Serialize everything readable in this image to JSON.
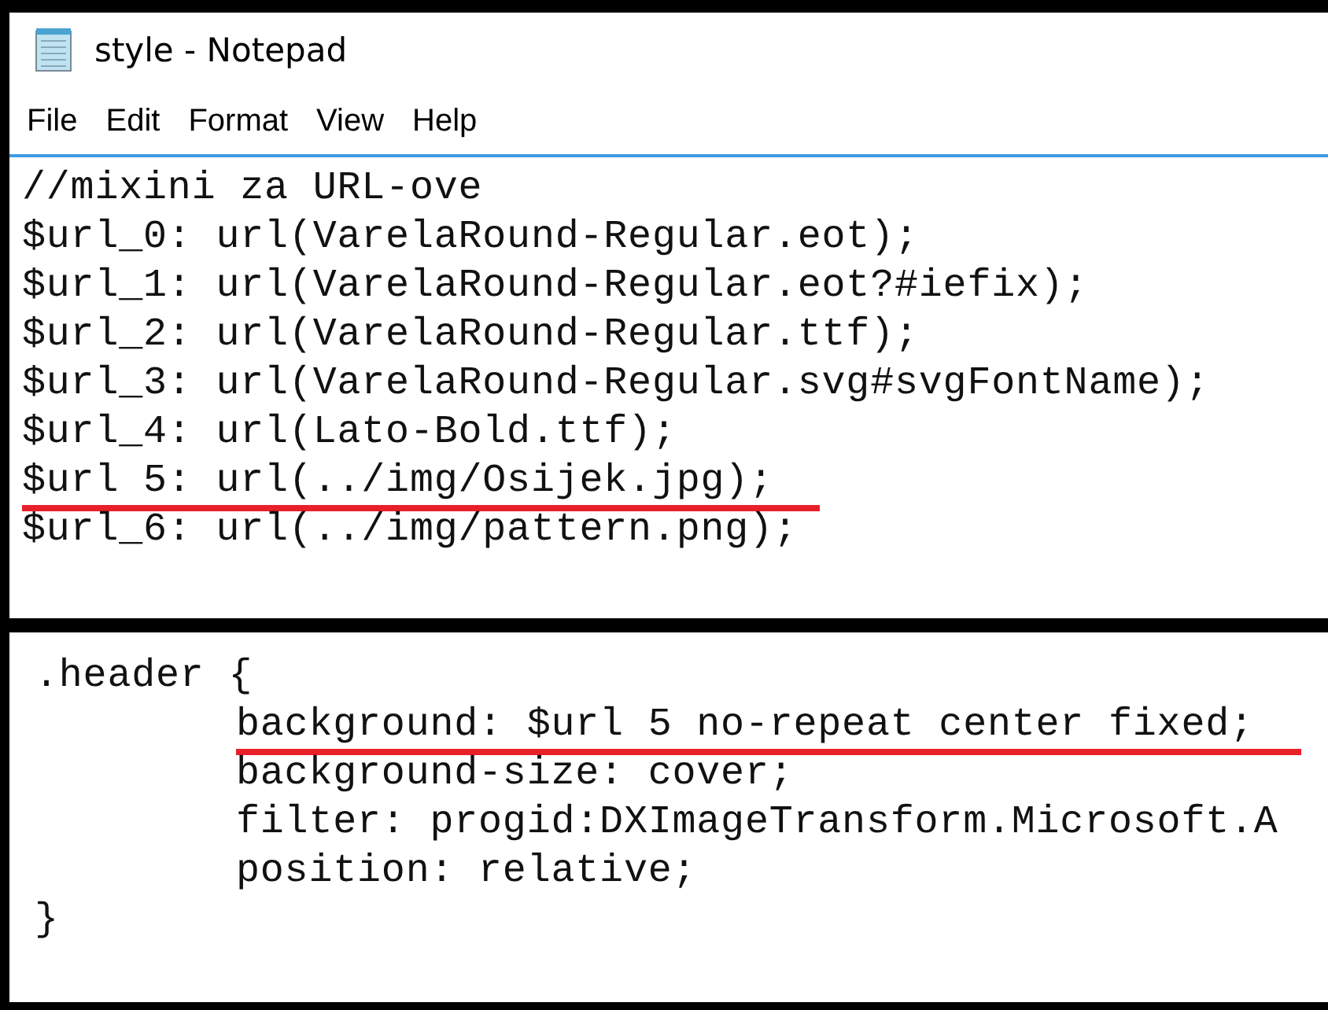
{
  "window": {
    "title": "style - Notepad"
  },
  "menu": [
    {
      "label": "File"
    },
    {
      "label": "Edit"
    },
    {
      "label": "Format"
    },
    {
      "label": "View"
    },
    {
      "label": "Help"
    }
  ],
  "editor": {
    "lines": [
      {
        "text": "//mixini za URL-ove",
        "underlined": false
      },
      {
        "text": "$url_0: url(VarelaRound-Regular.eot);",
        "underlined": false
      },
      {
        "text": "$url_1: url(VarelaRound-Regular.eot?#iefix);",
        "underlined": false
      },
      {
        "text": "$url_2: url(VarelaRound-Regular.ttf);",
        "underlined": false
      },
      {
        "text": "$url_3: url(VarelaRound-Regular.svg#svgFontName);",
        "underlined": false
      },
      {
        "text": "$url_4: url(Lato-Bold.ttf);",
        "underlined": false
      },
      {
        "text": "$url 5: url(../img/Osijek.jpg);",
        "underlined": true
      },
      {
        "text": "$url_6: url(../img/pattern.png);",
        "underlined": false
      }
    ]
  },
  "snippet": {
    "lines": [
      {
        "text": ".header {",
        "indented": false,
        "underlined": false
      },
      {
        "text": "background: $url 5 no-repeat center fixed;",
        "indented": true,
        "underlined": true
      },
      {
        "text": "background-size: cover;",
        "indented": true,
        "underlined": false
      },
      {
        "text": "filter: progid:DXImageTransform.Microsoft.A",
        "indented": true,
        "underlined": false
      },
      {
        "text": "position: relative;",
        "indented": true,
        "underlined": false
      },
      {
        "text": "}",
        "indented": false,
        "underlined": false
      }
    ]
  }
}
